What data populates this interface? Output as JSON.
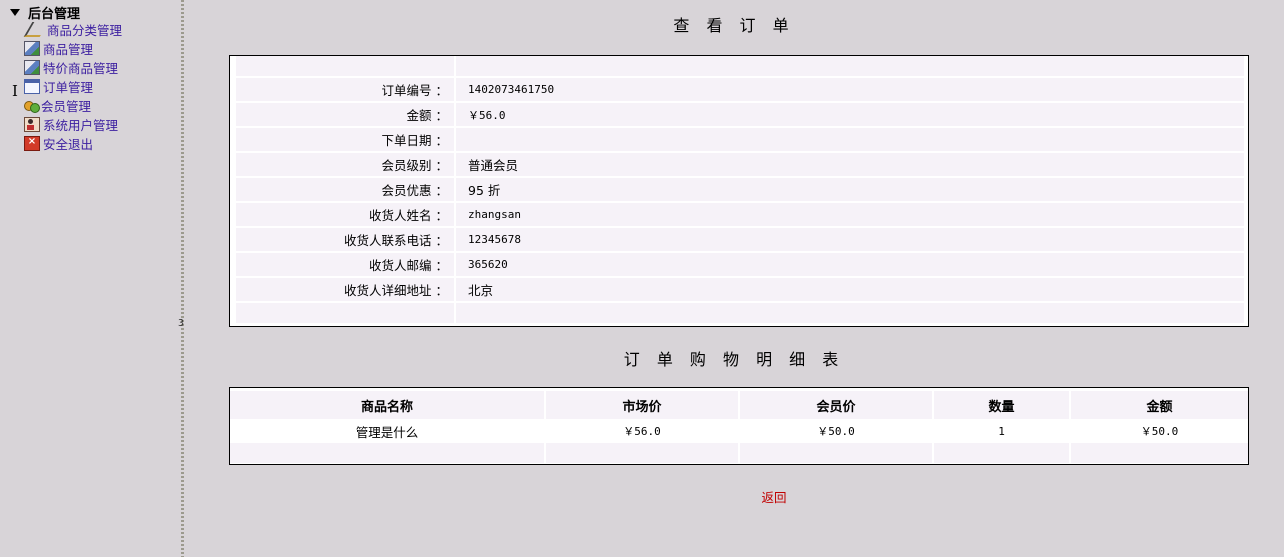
{
  "sidebar": {
    "root_label": "后台管理",
    "items": [
      {
        "label": "商品分类管理",
        "icon": "pencil-icon"
      },
      {
        "label": "商品管理",
        "icon": "image-icon"
      },
      {
        "label": "特价商品管理",
        "icon": "image-icon"
      },
      {
        "label": "订单管理",
        "icon": "window-icon"
      },
      {
        "label": "会员管理",
        "icon": "users-icon"
      },
      {
        "label": "系统用户管理",
        "icon": "person-icon"
      },
      {
        "label": "安全退出",
        "icon": "exit-icon"
      }
    ],
    "splitter_mark": "3"
  },
  "order": {
    "title": "查 看 订 单",
    "fields": [
      {
        "label": "订单编号 ：",
        "value": "1402073461750"
      },
      {
        "label": "金额 ：",
        "value": "￥56.0"
      },
      {
        "label": "下单日期 ：",
        "value": ""
      },
      {
        "label": "会员级别 ：",
        "value": "普通会员"
      },
      {
        "label": "会员优惠 ：",
        "value": "95 折"
      },
      {
        "label": "收货人姓名 ：",
        "value": "zhangsan"
      },
      {
        "label": "收货人联系电话 ：",
        "value": "12345678"
      },
      {
        "label": "收货人邮编 ：",
        "value": "365620"
      },
      {
        "label": "收货人详细地址 ：",
        "value": "北京"
      }
    ]
  },
  "details": {
    "title": "订 单 购 物 明 细 表",
    "columns": [
      "商品名称",
      "市场价",
      "会员价",
      "数量",
      "金额"
    ],
    "rows": [
      {
        "name": "管理是什么",
        "market_price": "￥56.0",
        "member_price": "￥50.0",
        "quantity": "1",
        "amount": "￥50.0"
      }
    ]
  },
  "back_label": "返回"
}
